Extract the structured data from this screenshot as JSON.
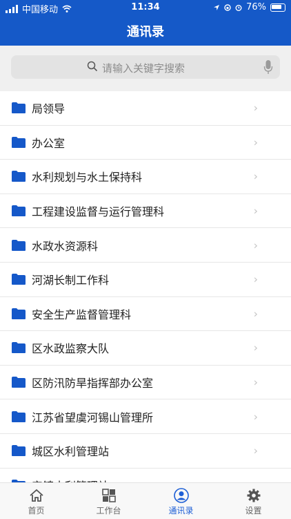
{
  "statusbar": {
    "carrier": "中国移动",
    "time": "11:34",
    "battery": "76%"
  },
  "navbar": {
    "title": "通讯录"
  },
  "search": {
    "placeholder": "请输入关键字搜索"
  },
  "departments": [
    "局领导",
    "办公室",
    "水利规划与水土保持科",
    "工程建设监督与运行管理科",
    "水政水资源科",
    "河湖长制工作科",
    "安全生产监督管理科",
    "区水政监察大队",
    "区防汛防旱指挥部办公室",
    "江苏省望虞河锡山管理所",
    "城区水利管理站",
    "安镇水利管理站"
  ],
  "tabs": [
    {
      "label": "首页",
      "icon": "home-icon"
    },
    {
      "label": "工作台",
      "icon": "grid-icon"
    },
    {
      "label": "通讯录",
      "icon": "contacts-icon",
      "active": true
    },
    {
      "label": "设置",
      "icon": "gear-icon"
    }
  ],
  "colors": {
    "brand": "#1559c8",
    "folder": "#1558c9",
    "activeTab": "#1e5fd6"
  }
}
